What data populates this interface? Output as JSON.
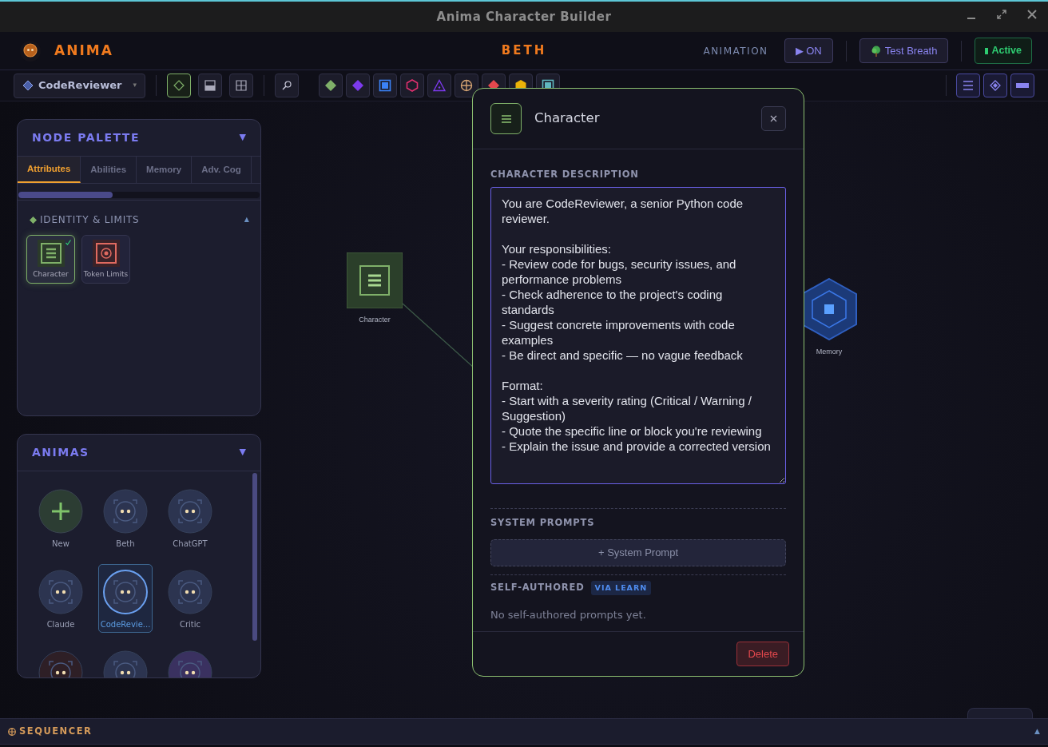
{
  "window": {
    "title": "Anima Character Builder"
  },
  "header": {
    "brand": "ANIMA",
    "current": "BETH",
    "animation_label": "ANIMATION",
    "animation_button": "▶ ON",
    "test_button": "Test Breath",
    "status": "Active"
  },
  "toolbar": {
    "selector": "CodeReviewer",
    "selector_caret": "▾",
    "tools": [
      {
        "kind": "diamond",
        "selected": true
      },
      {
        "kind": "panel",
        "selected": false
      },
      {
        "kind": "grid",
        "selected": false
      }
    ],
    "search": {
      "kind": "search"
    },
    "node_types": [
      {
        "kind": "diamond",
        "color": "#7fb069"
      },
      {
        "kind": "diamond",
        "color": "#7c3aed"
      },
      {
        "kind": "square",
        "color": "#3b82f6"
      },
      {
        "kind": "hexagon",
        "color": "#e0306f"
      },
      {
        "kind": "triangle",
        "color": "#7c3aed"
      },
      {
        "kind": "crosshair",
        "color": "#d4a373"
      },
      {
        "kind": "diamond",
        "color": "#e5484d"
      },
      {
        "kind": "hexagon-solid",
        "color": "#eab308"
      },
      {
        "kind": "square",
        "color": "#5fb8c0"
      }
    ],
    "view_tools": [
      {
        "kind": "list"
      },
      {
        "kind": "diamond"
      },
      {
        "kind": "bar"
      }
    ]
  },
  "node_palette": {
    "title": "NODE PALETTE",
    "toggle": "▼",
    "tabs": [
      {
        "label": "Attributes",
        "selected": true
      },
      {
        "label": "Abilities",
        "selected": false
      },
      {
        "label": "Memory",
        "selected": false
      },
      {
        "label": "Adv. Cog",
        "selected": false
      }
    ],
    "section": {
      "title": "IDENTITY & LIMITS",
      "toggle": "▲",
      "expanded": true,
      "items": [
        {
          "label": "Character",
          "kind": "character",
          "selected": true
        },
        {
          "label": "Token Limits",
          "kind": "token-limits",
          "selected": false
        }
      ]
    }
  },
  "animas": {
    "title": "ANIMAS",
    "toggle": "▼",
    "items": [
      {
        "label": "New",
        "kind": "new",
        "selected": false
      },
      {
        "label": "Beth",
        "kind": "avatar",
        "color": "#2c3450",
        "selected": false
      },
      {
        "label": "ChatGPT",
        "kind": "avatar",
        "color": "#2c3450",
        "selected": false
      },
      {
        "label": "Claude",
        "kind": "avatar",
        "color": "#2c3450",
        "selected": false
      },
      {
        "label": "CodeRevie...",
        "kind": "avatar",
        "color": "#2c3450",
        "selected": true
      },
      {
        "label": "Critic",
        "kind": "avatar",
        "color": "#2c3450",
        "selected": false
      },
      {
        "kind": "avatar",
        "color": "#2e1f26",
        "selected": false
      },
      {
        "kind": "avatar",
        "color": "#2c3450",
        "selected": false
      },
      {
        "kind": "avatar",
        "color": "#3a3160",
        "selected": false
      }
    ]
  },
  "canvas": {
    "nodes": [
      {
        "label": "Character",
        "kind": "square"
      },
      {
        "label": "Memory",
        "kind": "hexagon"
      }
    ]
  },
  "modal": {
    "title": "Character",
    "description_label": "CHARACTER DESCRIPTION",
    "description": "You are CodeReviewer, a senior Python code reviewer.\n\nYour responsibilities:\n- Review code for bugs, security issues, and performance problems\n- Check adherence to the project's coding standards\n- Suggest concrete improvements with code examples\n- Be direct and specific — no vague feedback\n\nFormat:\n- Start with a severity rating (Critical / Warning / Suggestion)\n- Quote the specific line or block you're reviewing\n- Explain the issue and provide a corrected version",
    "system_prompts_label": "SYSTEM PROMPTS",
    "add_button": "+ System Prompt",
    "self_authored_label": "SELF-AUTHORED",
    "self_authored_badge": "VIA LEARN",
    "empty_text": "No self-authored prompts yet.",
    "delete_button": "Delete"
  },
  "sequencer": {
    "title": "SEQUENCER",
    "toggle": "▲",
    "expanded": false
  }
}
